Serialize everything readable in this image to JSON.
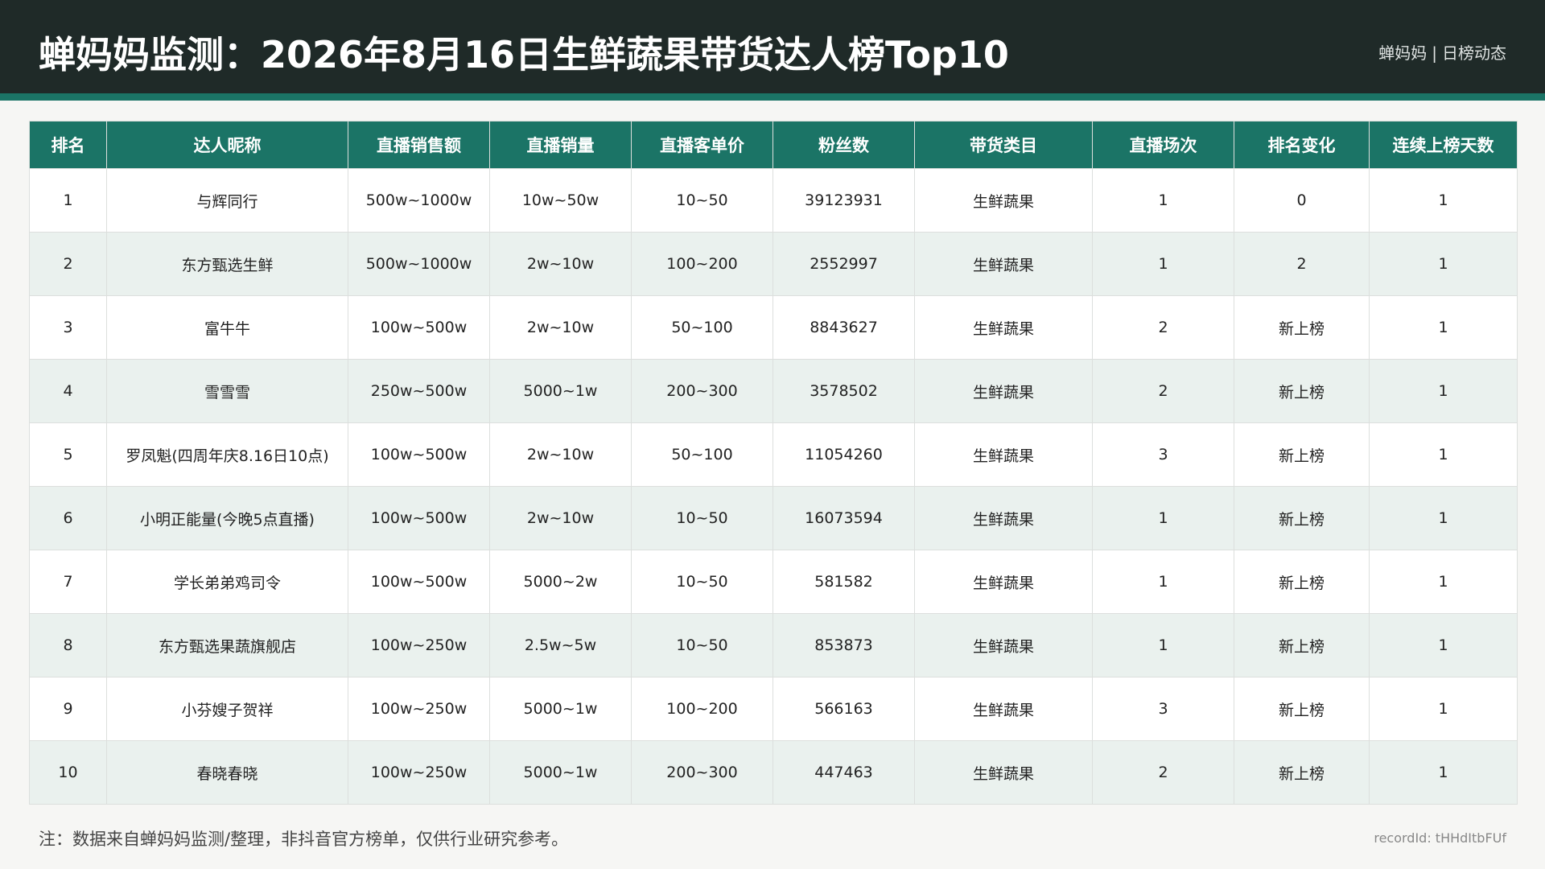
{
  "header": {
    "title": "蝉妈妈监测：2026年8月16日生鲜蔬果带货达人榜Top10",
    "brand": "蝉妈妈",
    "separator": "|",
    "subtitle": "日榜动态"
  },
  "table": {
    "columns": [
      "排名",
      "达人昵称",
      "直播销售额",
      "直播销量",
      "直播客单价",
      "粉丝数",
      "带货类目",
      "直播场次",
      "排名变化",
      "连续上榜天数"
    ],
    "rows": [
      [
        "1",
        "与辉同行",
        "500w~1000w",
        "10w~50w",
        "10~50",
        "39123931",
        "生鲜蔬果",
        "1",
        "0",
        "1"
      ],
      [
        "2",
        "东方甄选生鲜",
        "500w~1000w",
        "2w~10w",
        "100~200",
        "2552997",
        "生鲜蔬果",
        "1",
        "2",
        "1"
      ],
      [
        "3",
        "富牛牛",
        "100w~500w",
        "2w~10w",
        "50~100",
        "8843627",
        "生鲜蔬果",
        "2",
        "新上榜",
        "1"
      ],
      [
        "4",
        "雪雪雪",
        "250w~500w",
        "5000~1w",
        "200~300",
        "3578502",
        "生鲜蔬果",
        "2",
        "新上榜",
        "1"
      ],
      [
        "5",
        "罗凤魁(四周年庆8.16日10点)",
        "100w~500w",
        "2w~10w",
        "50~100",
        "11054260",
        "生鲜蔬果",
        "3",
        "新上榜",
        "1"
      ],
      [
        "6",
        "小明正能量(今晚5点直播)",
        "100w~500w",
        "2w~10w",
        "10~50",
        "16073594",
        "生鲜蔬果",
        "1",
        "新上榜",
        "1"
      ],
      [
        "7",
        "学长弟弟鸡司令",
        "100w~500w",
        "5000~2w",
        "10~50",
        "581582",
        "生鲜蔬果",
        "1",
        "新上榜",
        "1"
      ],
      [
        "8",
        "东方甄选果蔬旗舰店",
        "100w~250w",
        "2.5w~5w",
        "10~50",
        "853873",
        "生鲜蔬果",
        "1",
        "新上榜",
        "1"
      ],
      [
        "9",
        "小芬嫂子贺祥",
        "100w~250w",
        "5000~1w",
        "100~200",
        "566163",
        "生鲜蔬果",
        "3",
        "新上榜",
        "1"
      ],
      [
        "10",
        "春晓春晓",
        "100w~250w",
        "5000~1w",
        "200~300",
        "447463",
        "生鲜蔬果",
        "2",
        "新上榜",
        "1"
      ]
    ]
  },
  "footer": {
    "note": "注：数据来自蝉妈妈监测/整理，非抖音官方榜单，仅供行业研究参考。",
    "record": "recordId: tHHdItbFUf"
  }
}
